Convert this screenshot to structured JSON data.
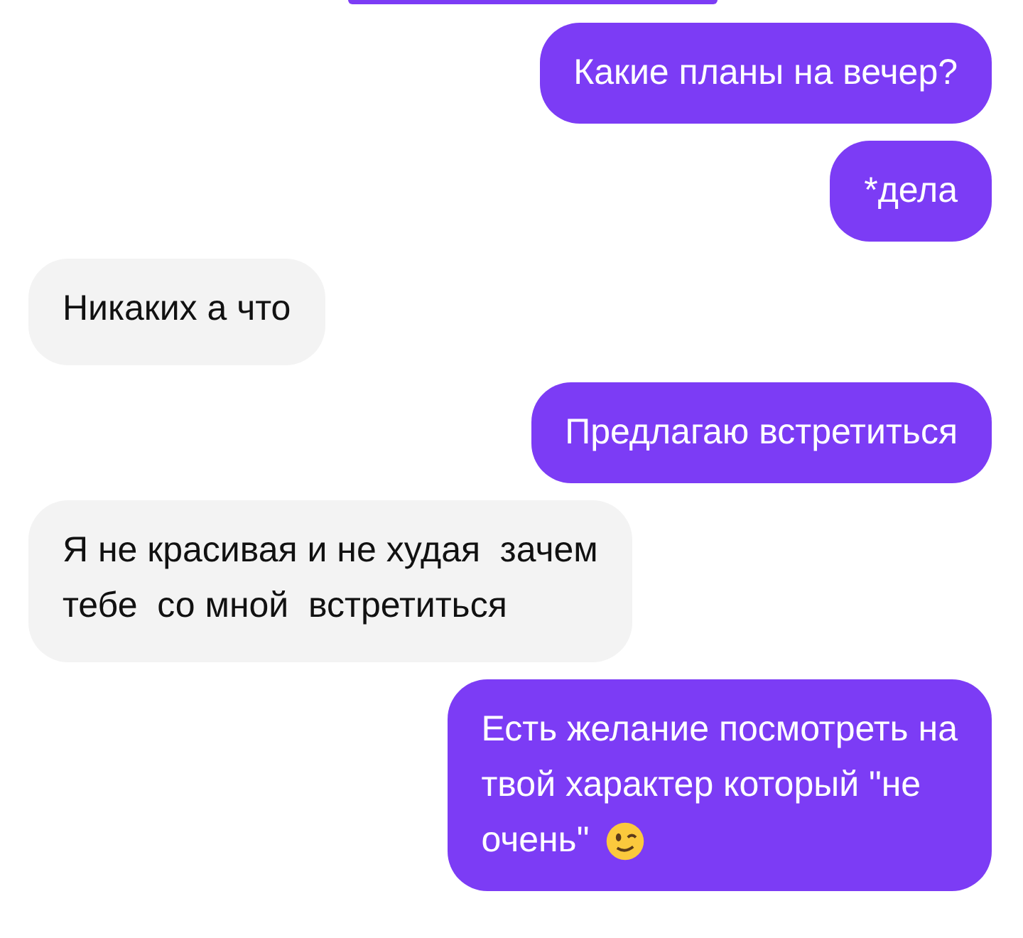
{
  "messages": [
    {
      "kind": "sent",
      "lines": [
        "Какие планы на вечер?"
      ]
    },
    {
      "kind": "sent",
      "lines": [
        "*дела"
      ]
    },
    {
      "kind": "received",
      "lines": [
        "Никаких а что"
      ]
    },
    {
      "kind": "sent",
      "lines": [
        "Предлагаю встретиться"
      ]
    },
    {
      "kind": "received",
      "lines": [
        "Я не красивая и не худая  зачем",
        "тебе  со мной  встретиться"
      ]
    },
    {
      "kind": "sent",
      "lines": [
        "Есть желание посмотреть на",
        "твой характер который \"не",
        "очень\""
      ],
      "wink_emoji": true
    }
  ]
}
